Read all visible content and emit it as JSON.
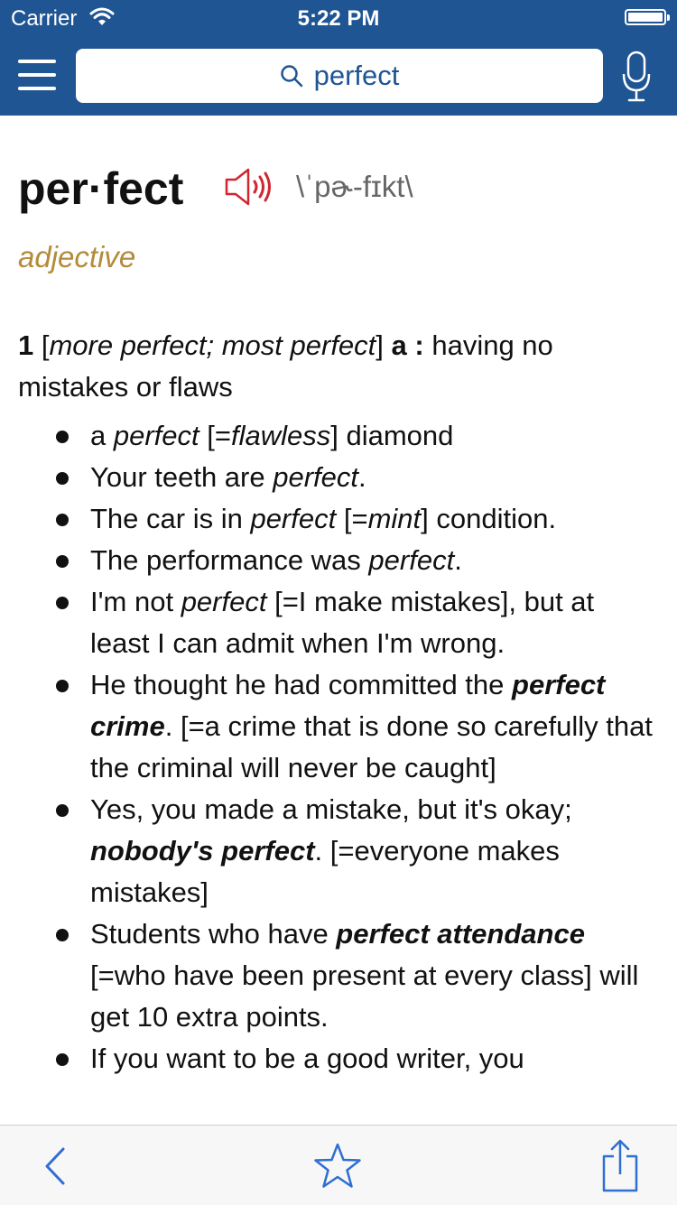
{
  "status_bar": {
    "carrier": "Carrier",
    "time": "5:22 PM"
  },
  "nav": {
    "search_value": "perfect"
  },
  "entry": {
    "headword": "per·fect",
    "pronunciation": "\\ˈpɚ-fɪkt\\",
    "part_of_speech": "adjective",
    "sense": {
      "number": "1",
      "bracket_open": " [",
      "forms": "more perfect; most perfect",
      "bracket_close": "] ",
      "letter": "a :",
      "definition": " having no mistakes or flaws"
    },
    "examples": [
      [
        {
          "t": "a ",
          "s": "n"
        },
        {
          "t": "perfect",
          "s": "i"
        },
        {
          "t": " [=",
          "s": "n"
        },
        {
          "t": "flawless",
          "s": "i"
        },
        {
          "t": "] diamond",
          "s": "n"
        }
      ],
      [
        {
          "t": "Your teeth are ",
          "s": "n"
        },
        {
          "t": "perfect",
          "s": "i"
        },
        {
          "t": ".",
          "s": "n"
        }
      ],
      [
        {
          "t": "The car is in ",
          "s": "n"
        },
        {
          "t": "perfect",
          "s": "i"
        },
        {
          "t": " [=",
          "s": "n"
        },
        {
          "t": "mint",
          "s": "i"
        },
        {
          "t": "] condition.",
          "s": "n"
        }
      ],
      [
        {
          "t": "The performance was ",
          "s": "n"
        },
        {
          "t": "perfect",
          "s": "i"
        },
        {
          "t": ".",
          "s": "n"
        }
      ],
      [
        {
          "t": "I'm not ",
          "s": "n"
        },
        {
          "t": "perfect",
          "s": "i"
        },
        {
          "t": " [=I make mistakes], but at least I can admit when I'm wrong.",
          "s": "n"
        }
      ],
      [
        {
          "t": "He thought he had committed the ",
          "s": "n"
        },
        {
          "t": "perfect crime",
          "s": "bi"
        },
        {
          "t": ". [=a crime that is done so carefully that the criminal will never be caught]",
          "s": "n"
        }
      ],
      [
        {
          "t": "Yes, you made a mistake, but it's okay; ",
          "s": "n"
        },
        {
          "t": "nobody's perfect",
          "s": "bi"
        },
        {
          "t": ". [=everyone makes mistakes]",
          "s": "n"
        }
      ],
      [
        {
          "t": "Students who have ",
          "s": "n"
        },
        {
          "t": "perfect attendance",
          "s": "bi"
        },
        {
          "t": " [=who have been present at every class] will get 10 extra points.",
          "s": "n"
        }
      ],
      [
        {
          "t": "If you want to be a good writer, you",
          "s": "n"
        }
      ]
    ]
  },
  "toolbar": {
    "back_icon": "chevron-left-icon",
    "favorite_icon": "star-icon",
    "share_icon": "share-icon"
  },
  "colors": {
    "nav_bar": "#1f5593",
    "accent": "#2f6fd1",
    "part_of_speech": "#b38b3a",
    "speaker": "#d0262f"
  }
}
